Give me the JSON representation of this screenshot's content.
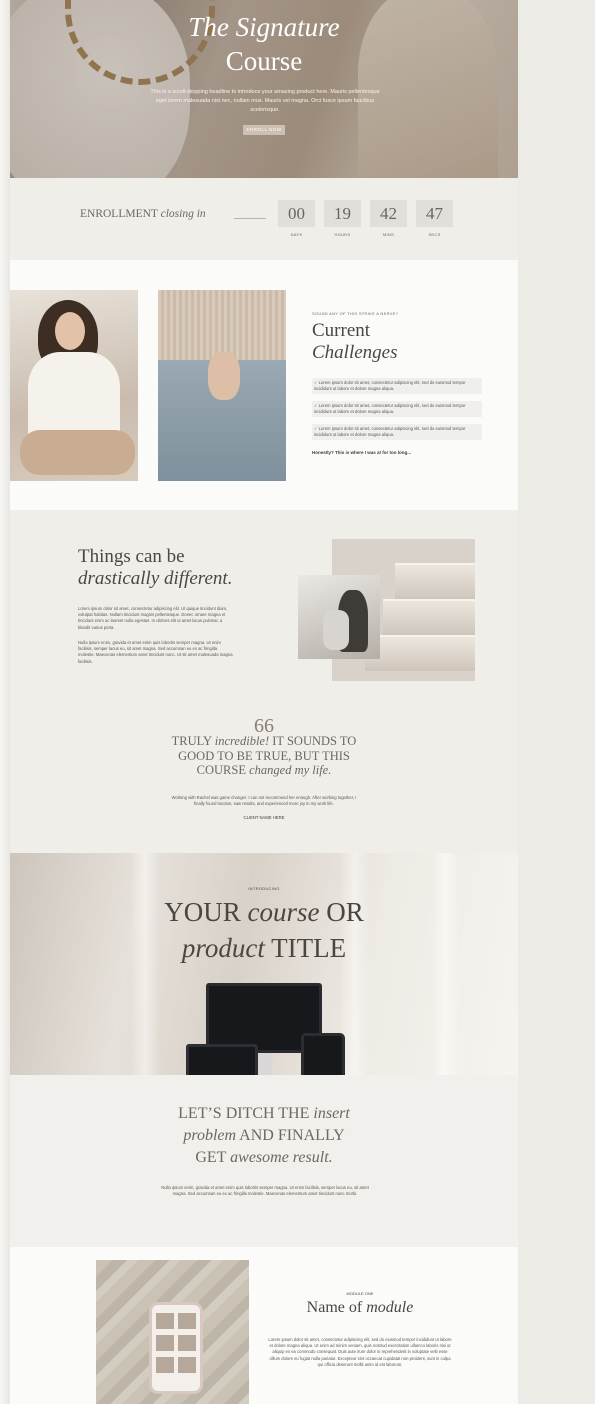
{
  "hero": {
    "title_line1": "The Signature",
    "title_line2": "Course",
    "blurb": "This is a scroll-stopping headline to introduce your amazing product here. Mauris pellentesque eget lorem malesuada nisi nec, nullam mus. Mauris vel magna. Orci fusce ipsum faucibus scelerisque.",
    "button": "ENROLL NOW"
  },
  "enrollment": {
    "label": "ENROLLMENT",
    "label_italic": "closing in",
    "countdown": [
      {
        "value": "00",
        "unit": "DAYS"
      },
      {
        "value": "19",
        "unit": "HOURS"
      },
      {
        "value": "42",
        "unit": "MINS"
      },
      {
        "value": "47",
        "unit": "SECS"
      }
    ]
  },
  "challenges": {
    "eyebrow": "SOUND ANY OF THIS STRIKE A NERVE?",
    "title_line1": "Current",
    "title_line2": "Challenges",
    "items": [
      "✓ Lorem ipsum dolor sit amet, consectetur adipiscing elit, sed do euismod tempor incididunt ut labore et dolore magna aliqua.",
      "✓ Lorem ipsum dolor sit amet, consectetur adipiscing elit, sed do euismod tempor incididunt ut labore et dolore magna aliqua.",
      "✓ Lorem ipsum dolor sit amet, consectetur adipiscing elit, sed do euismod tempor incididunt ut labore et dolore magna aliqua."
    ],
    "closing": "Honestly? This is where I was at for too long..."
  },
  "different": {
    "title_line1": "Things can be",
    "title_line2": "drastically different.",
    "para1": "Lorem ipsum dolor sit amet, consectetur adipiscing elit. Ut quique tincidunt diam, volutpat habitas. Nullam tincidunt magnis pellentesque. Donec ornare magna et tincidunt enim ac laoreet nulla egestas. In ultrices elit ut amet lacus pulvinar, a blandit varius porta.",
    "para2": "Nulla ipsum enim, gravida et amet enim quis lobortis semper magna. Ut enim facilisis, semper lacus eu, sit amet magna. Sed accumsan eu ex ac fringilla molestie. Maecenas elementum amet tincidunt nunc. Ut sit amet malesuada magna facilisis."
  },
  "testimonial": {
    "mark": "66",
    "quote_a": "TRULY ",
    "quote_b": "incredible!",
    "quote_c": " IT SOUNDS TO GOOD TO BE TRUE, BUT THIS COURSE ",
    "quote_d": "changed my life.",
    "body": "Working with Rachel was game changer. I can not recommend her enough. After working together, I finally found traction, saw results, and experienced more joy in my work life.",
    "name": "CLIENT NAME HERE"
  },
  "product": {
    "eyebrow": "INTRODUCING",
    "line1_a": "YOUR ",
    "line1_b": "course",
    "line1_c": " OR",
    "line2_a": "product",
    "line2_b": " TITLE"
  },
  "ditch": {
    "l1_a": "LET’S DITCH THE ",
    "l1_b": "insert",
    "l2_a": "problem",
    "l2_b": " AND FINALLY",
    "l3_a": "GET ",
    "l3_b": "awesome result.",
    "para": "Nulla ipsum enim, gravida et amet enim quis lobortis semper magna. Ut enim facilisis, semper lacus eu, sit amet magna. Sed accumsan eu ex ac fringilla molestie. Maecenas elementum amet tincidunt nunc morbi."
  },
  "module": {
    "eyebrow": "MODULE ONE",
    "title_a": "Name of ",
    "title_b": "module",
    "para": "Lorem ipsum dolor sit amet, consectetur adipiscing elit, sed do eiusmod tempor incididunt ut labore et dolore magna aliqua. Ut enim ad minim veniam, quis nostrud exercitation ullamco laboris nisi ut aliquip ex ea commodo consequat. Duis aute irure dolor in reprehenderit in voluptate velit esse cillum dolore eu fugiat nulla pariatur. Excepteur sint occaecat cupidatat non proident, sunt in culpa qui officia deserunt mollit anim id est laborum."
  },
  "colors": {
    "background": "#f2f1ed",
    "accent": "#cdbfb1",
    "text": "#4b4740"
  }
}
